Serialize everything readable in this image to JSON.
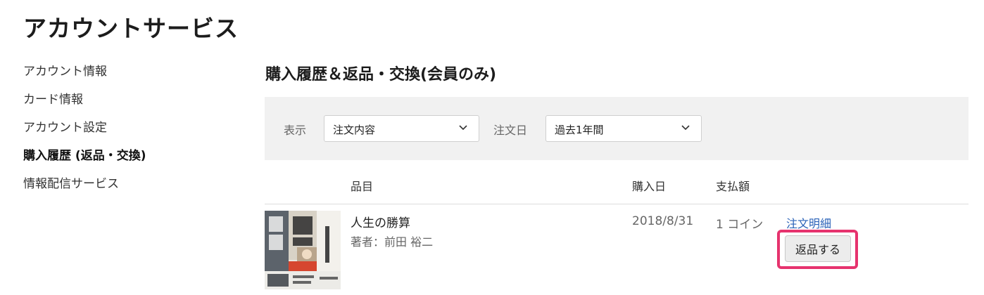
{
  "header": {
    "title": "アカウントサービス"
  },
  "sidebar": {
    "items": [
      {
        "label": "アカウント情報",
        "active": false
      },
      {
        "label": "カード情報",
        "active": false
      },
      {
        "label": "アカウント設定",
        "active": false
      },
      {
        "label": "購入履歴 (返品・交換)",
        "active": true
      },
      {
        "label": "情報配信サービス",
        "active": false
      }
    ]
  },
  "main": {
    "section_title": "購入履歴＆返品・交換(会員のみ)",
    "filters": {
      "display_label": "表示",
      "display_value": "注文内容",
      "date_label": "注文日",
      "date_value": "過去1年間"
    },
    "table": {
      "columns": {
        "item": "品目",
        "date": "購入日",
        "amount": "支払額"
      },
      "rows": [
        {
          "title": "人生の勝算",
          "author": "著者：前田 裕二",
          "date": "2018/8/31",
          "amount": "1 コイン",
          "order_link": "注文明細",
          "return_button": "返品する"
        }
      ]
    }
  },
  "colors": {
    "link": "#2a62b8",
    "highlight": "#e6336e",
    "filter_background": "#f1f1f1"
  },
  "icons": {
    "dropdown": "chevron-down-icon"
  }
}
